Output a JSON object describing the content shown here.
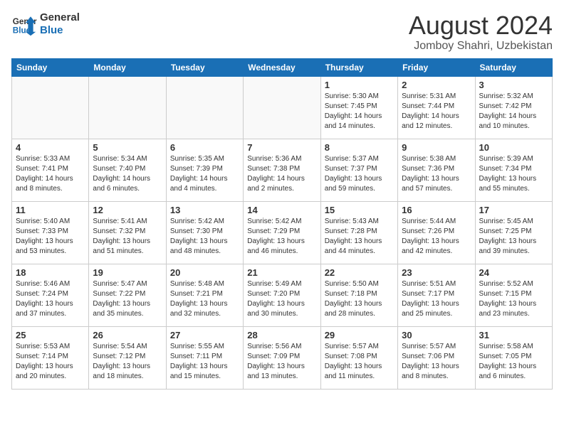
{
  "header": {
    "logo_line1": "General",
    "logo_line2": "Blue",
    "month_year": "August 2024",
    "location": "Jomboy Shahri, Uzbekistan"
  },
  "weekdays": [
    "Sunday",
    "Monday",
    "Tuesday",
    "Wednesday",
    "Thursday",
    "Friday",
    "Saturday"
  ],
  "weeks": [
    [
      {
        "day": "",
        "info": ""
      },
      {
        "day": "",
        "info": ""
      },
      {
        "day": "",
        "info": ""
      },
      {
        "day": "",
        "info": ""
      },
      {
        "day": "1",
        "info": "Sunrise: 5:30 AM\nSunset: 7:45 PM\nDaylight: 14 hours\nand 14 minutes."
      },
      {
        "day": "2",
        "info": "Sunrise: 5:31 AM\nSunset: 7:44 PM\nDaylight: 14 hours\nand 12 minutes."
      },
      {
        "day": "3",
        "info": "Sunrise: 5:32 AM\nSunset: 7:42 PM\nDaylight: 14 hours\nand 10 minutes."
      }
    ],
    [
      {
        "day": "4",
        "info": "Sunrise: 5:33 AM\nSunset: 7:41 PM\nDaylight: 14 hours\nand 8 minutes."
      },
      {
        "day": "5",
        "info": "Sunrise: 5:34 AM\nSunset: 7:40 PM\nDaylight: 14 hours\nand 6 minutes."
      },
      {
        "day": "6",
        "info": "Sunrise: 5:35 AM\nSunset: 7:39 PM\nDaylight: 14 hours\nand 4 minutes."
      },
      {
        "day": "7",
        "info": "Sunrise: 5:36 AM\nSunset: 7:38 PM\nDaylight: 14 hours\nand 2 minutes."
      },
      {
        "day": "8",
        "info": "Sunrise: 5:37 AM\nSunset: 7:37 PM\nDaylight: 13 hours\nand 59 minutes."
      },
      {
        "day": "9",
        "info": "Sunrise: 5:38 AM\nSunset: 7:36 PM\nDaylight: 13 hours\nand 57 minutes."
      },
      {
        "day": "10",
        "info": "Sunrise: 5:39 AM\nSunset: 7:34 PM\nDaylight: 13 hours\nand 55 minutes."
      }
    ],
    [
      {
        "day": "11",
        "info": "Sunrise: 5:40 AM\nSunset: 7:33 PM\nDaylight: 13 hours\nand 53 minutes."
      },
      {
        "day": "12",
        "info": "Sunrise: 5:41 AM\nSunset: 7:32 PM\nDaylight: 13 hours\nand 51 minutes."
      },
      {
        "day": "13",
        "info": "Sunrise: 5:42 AM\nSunset: 7:30 PM\nDaylight: 13 hours\nand 48 minutes."
      },
      {
        "day": "14",
        "info": "Sunrise: 5:42 AM\nSunset: 7:29 PM\nDaylight: 13 hours\nand 46 minutes."
      },
      {
        "day": "15",
        "info": "Sunrise: 5:43 AM\nSunset: 7:28 PM\nDaylight: 13 hours\nand 44 minutes."
      },
      {
        "day": "16",
        "info": "Sunrise: 5:44 AM\nSunset: 7:26 PM\nDaylight: 13 hours\nand 42 minutes."
      },
      {
        "day": "17",
        "info": "Sunrise: 5:45 AM\nSunset: 7:25 PM\nDaylight: 13 hours\nand 39 minutes."
      }
    ],
    [
      {
        "day": "18",
        "info": "Sunrise: 5:46 AM\nSunset: 7:24 PM\nDaylight: 13 hours\nand 37 minutes."
      },
      {
        "day": "19",
        "info": "Sunrise: 5:47 AM\nSunset: 7:22 PM\nDaylight: 13 hours\nand 35 minutes."
      },
      {
        "day": "20",
        "info": "Sunrise: 5:48 AM\nSunset: 7:21 PM\nDaylight: 13 hours\nand 32 minutes."
      },
      {
        "day": "21",
        "info": "Sunrise: 5:49 AM\nSunset: 7:20 PM\nDaylight: 13 hours\nand 30 minutes."
      },
      {
        "day": "22",
        "info": "Sunrise: 5:50 AM\nSunset: 7:18 PM\nDaylight: 13 hours\nand 28 minutes."
      },
      {
        "day": "23",
        "info": "Sunrise: 5:51 AM\nSunset: 7:17 PM\nDaylight: 13 hours\nand 25 minutes."
      },
      {
        "day": "24",
        "info": "Sunrise: 5:52 AM\nSunset: 7:15 PM\nDaylight: 13 hours\nand 23 minutes."
      }
    ],
    [
      {
        "day": "25",
        "info": "Sunrise: 5:53 AM\nSunset: 7:14 PM\nDaylight: 13 hours\nand 20 minutes."
      },
      {
        "day": "26",
        "info": "Sunrise: 5:54 AM\nSunset: 7:12 PM\nDaylight: 13 hours\nand 18 minutes."
      },
      {
        "day": "27",
        "info": "Sunrise: 5:55 AM\nSunset: 7:11 PM\nDaylight: 13 hours\nand 15 minutes."
      },
      {
        "day": "28",
        "info": "Sunrise: 5:56 AM\nSunset: 7:09 PM\nDaylight: 13 hours\nand 13 minutes."
      },
      {
        "day": "29",
        "info": "Sunrise: 5:57 AM\nSunset: 7:08 PM\nDaylight: 13 hours\nand 11 minutes."
      },
      {
        "day": "30",
        "info": "Sunrise: 5:57 AM\nSunset: 7:06 PM\nDaylight: 13 hours\nand 8 minutes."
      },
      {
        "day": "31",
        "info": "Sunrise: 5:58 AM\nSunset: 7:05 PM\nDaylight: 13 hours\nand 6 minutes."
      }
    ]
  ]
}
